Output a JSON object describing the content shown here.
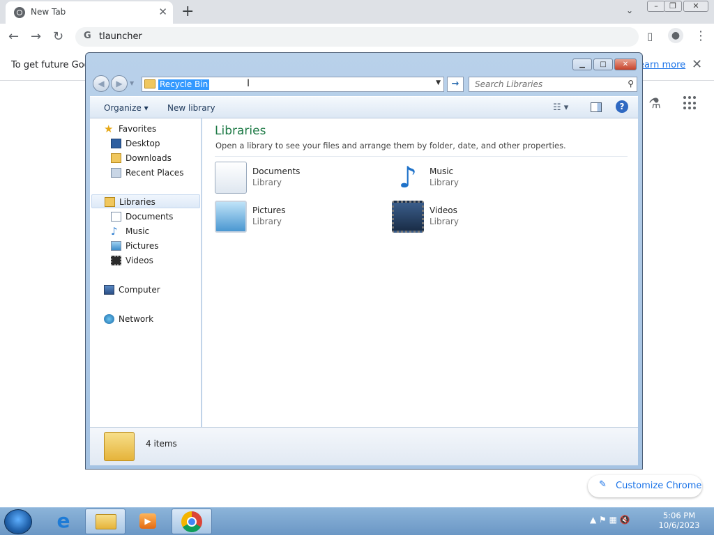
{
  "browser": {
    "tab_title": "New Tab",
    "tab_close": "✕",
    "new_tab": "+",
    "url": "tlauncher",
    "info_message": "To get future Goog",
    "info_link": "earn more",
    "info_close": "✕",
    "customize_label": "Customize Chrome"
  },
  "explorer": {
    "address": "Recycle Bin",
    "search_placeholder": "Search Libraries",
    "organize": "Organize ▾",
    "new_library": "New library",
    "nav": {
      "favorites": "Favorites",
      "desktop": "Desktop",
      "downloads": "Downloads",
      "recent": "Recent Places",
      "libraries": "Libraries",
      "documents": "Documents",
      "music": "Music",
      "pictures": "Pictures",
      "videos": "Videos",
      "computer": "Computer",
      "network": "Network"
    },
    "title": "Libraries",
    "description": "Open a library to see your files and arrange them by folder, date, and other properties.",
    "libraries": [
      {
        "name": "Documents",
        "type": "Library"
      },
      {
        "name": "Music",
        "type": "Library"
      },
      {
        "name": "Pictures",
        "type": "Library"
      },
      {
        "name": "Videos",
        "type": "Library"
      }
    ],
    "item_count": "4 items"
  },
  "taskbar": {
    "time": "5:06 PM",
    "date": "10/6/2023"
  }
}
